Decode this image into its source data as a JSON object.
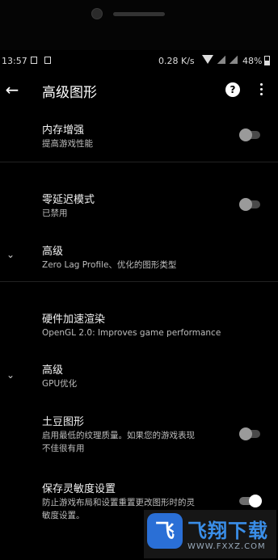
{
  "status_bar": {
    "time": "13:57",
    "network_speed": "0.28 K/s",
    "battery": "48%"
  },
  "toolbar": {
    "title": "高级图形",
    "help_glyph": "?"
  },
  "settings": [
    {
      "label": "内存增强",
      "subtitle": "提高游戏性能",
      "toggle_on": false
    },
    {
      "label": "零延迟模式",
      "subtitle": "已禁用",
      "toggle_on": false
    },
    {
      "label": "高级",
      "subtitle": "Zero Lag Profile、优化的图形类型"
    },
    {
      "label": "硬件加速渲染",
      "subtitle": "OpenGL 2.0: Improves game performance"
    },
    {
      "label": "高级",
      "subtitle": "GPU优化"
    },
    {
      "label": "土豆图形",
      "subtitle_line1": "启用最低的纹理质量。如果您的游戏表现",
      "subtitle_line2": "不佳很有用",
      "toggle_on": false
    },
    {
      "label": "保存灵敏度设置",
      "subtitle_line1": "防止游戏布局和设置重置更改图形时的灵",
      "subtitle_line2": "敏度设置。",
      "toggle_on": true
    }
  ],
  "watermark": {
    "logo_char": "飞",
    "name": "飞翔下载",
    "url": "WWW.FXXZ.COM"
  },
  "colors": {
    "background": "#000000",
    "toggle_on_knob": "#ffffff",
    "toggle_off_knob": "#9a9a9a"
  }
}
